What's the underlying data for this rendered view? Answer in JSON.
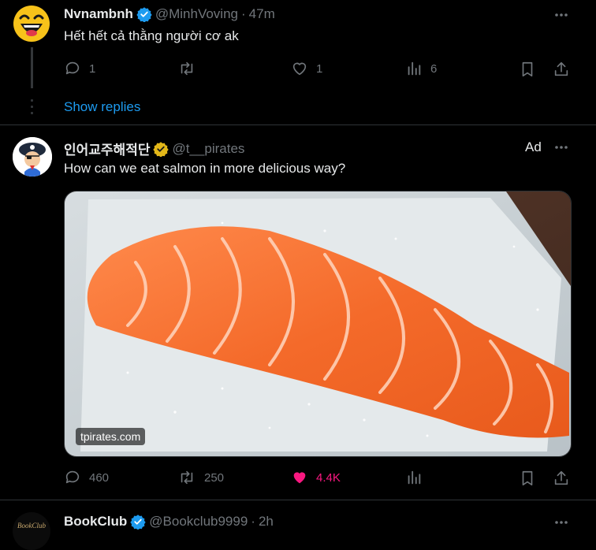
{
  "tweets": [
    {
      "name": "Nvnambnh",
      "handle": "@MinhVoving",
      "time": "47m",
      "text": "Hết hết cả thằng người cơ ak",
      "replies": "1",
      "retweets": "",
      "likes": "1",
      "views": "6",
      "show_replies": "Show replies"
    },
    {
      "name": "인어교주해적단",
      "handle": "@t__pirates",
      "ad_label": "Ad",
      "text": "How can we eat salmon in more delicious way?",
      "media_watermark": "tpirates.com",
      "replies": "460",
      "retweets": "250",
      "likes": "4.4K"
    },
    {
      "name": "BookClub",
      "handle": "@Bookclub9999",
      "time": "2h",
      "avatar_text": "BookClub"
    }
  ],
  "separator_dot": "·",
  "colors": {
    "accent_blue": "#1d9bf0",
    "gold_verified": "#e2b719",
    "like_pink": "#f91880",
    "muted": "#71767b"
  }
}
